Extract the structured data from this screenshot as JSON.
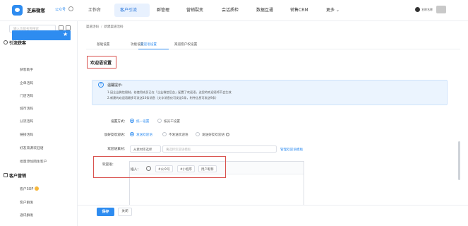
{
  "topbar": {
    "brand": "芝麻微客",
    "corp": "公众号",
    "nav": [
      "工作台",
      "客户引流",
      "群管理",
      "营销裂变",
      "会话质检",
      "数据互通",
      "销售CRM",
      "更多 ⌄"
    ],
    "active_nav": "客户引流",
    "user_text": "名称名称"
  },
  "sidebar": {
    "search_placeholder": "输入功能名称搜索",
    "group1": "引流获客",
    "group1_items": [
      "渠道活码",
      "获客助手",
      "企单活码",
      "门店活码",
      "城市活码",
      "分流活码",
      "链接活码",
      "好友来源欢迎语",
      "批量添加陌生客户"
    ],
    "group2": "客户营销",
    "group2_items": [
      "客户SOP",
      "客户群发",
      "通讯群发"
    ],
    "active_item": "渠道活码"
  },
  "breadcrumb": {
    "parent": "渠道活码",
    "current": "新建渠道活码"
  },
  "tabs": {
    "items": [
      "基础设置",
      "功能设置",
      "欢迎语设置",
      "渠道客户权设置"
    ],
    "active": "欢迎语设置"
  },
  "section": {
    "title": "欢迎语设置"
  },
  "tip": {
    "title": "温馨提示:",
    "line1": "1.因企业微信限制，若使用成员已在「企业微信后台」配置了欢迎语，这里的欢迎语将不会生效",
    "line2": "2.新建的欢迎语最多可发送10条消息（文字消息仅可发送1条，附件信息可发送9条）"
  },
  "form": {
    "setting_mode_label": "设置方式：",
    "setting_mode_options": [
      "统一设置",
      "按员工设置"
    ],
    "setting_mode_selected": "统一设置",
    "friend_greet_label": "加好友欢迎语：",
    "friend_greet_options": [
      "发送欢迎语",
      "不发送欢迎语",
      "发送好友欢迎语"
    ],
    "friend_greet_selected": "发送欢迎语",
    "material_label": "欢迎语素材：",
    "material_source": "从素材库选择",
    "material_placeholder": "请选择欢迎语模板",
    "manage_link": "管理欢迎语模板",
    "greet_label": "欢迎语：",
    "insert_label": "插入：",
    "chips": [
      "#公众号",
      "#小程序",
      "用户昵称"
    ]
  },
  "footer": {
    "save": "保存",
    "close": "关闭"
  },
  "colors": {
    "accent": "#2e8cf0",
    "highlight_box": "#d9534f",
    "tip_bg": "#ebf4fe"
  }
}
